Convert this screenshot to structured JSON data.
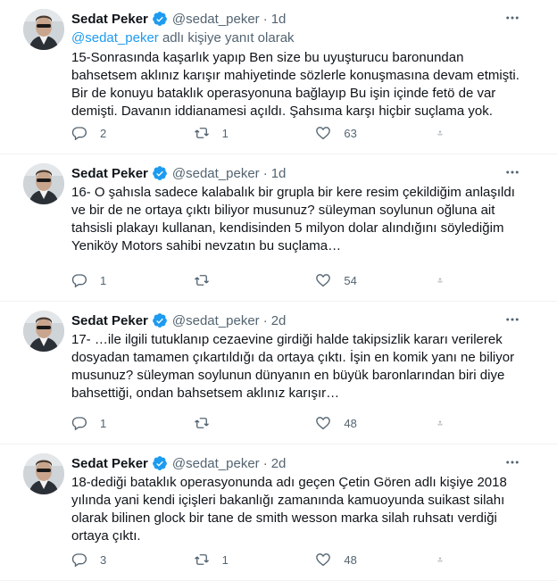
{
  "icons": {
    "reply": "reply-icon",
    "retweet": "retweet-icon",
    "like": "heart-icon",
    "share": "share-icon",
    "more": "more-icon",
    "verified": "verified-badge-icon"
  },
  "colors": {
    "verified": "#1d9bf0",
    "mention": "#1d9bf0",
    "secondary": "#536471"
  },
  "tweets": [
    {
      "name": "Sedat Peker",
      "handle": "@sedat_peker",
      "dot": "·",
      "time": "1d",
      "reply_to_prefix": "",
      "reply_to_mention": "@sedat_peker",
      "reply_to_suffix": " adlı kişiye yanıt olarak",
      "text": "15-Sonrasında kaşarlık yapıp Ben size bu uyuşturucu baronundan bahsetsem aklınız karışır mahiyetinde sözlerle konuşmasına devam etmişti. Bir de konuyu bataklık operasyonuna bağlayıp Bu işin içinde fetö de var demişti. Davanın iddianamesi açıldı.  Şahsıma karşı hiçbir suçlama yok.",
      "replies": "2",
      "retweets": "1",
      "likes": "63"
    },
    {
      "name": "Sedat Peker",
      "handle": "@sedat_peker",
      "dot": "·",
      "time": "1d",
      "text": "16- O şahısla sadece kalabalık bir grupla bir kere resim çekildiğim anlaşıldı ve bir de ne ortaya çıktı biliyor musunuz? süleyman soylunun oğluna ait tahsisli plakayı kullanan, kendisinden 5 milyon dolar alındığını söylediğim Yeniköy Motors sahibi nevzatın bu suçlama…",
      "replies": "1",
      "retweets": "",
      "likes": "54"
    },
    {
      "name": "Sedat Peker",
      "handle": "@sedat_peker",
      "dot": "·",
      "time": "2d",
      "text": "17- …ile ilgili tutuklanıp cezaevine girdiği halde takipsizlik kararı verilerek dosyadan tamamen çıkartıldığı da ortaya çıktı. İşin en komik yanı ne biliyor musunuz? süleyman soylunun dünyanın en büyük baronlarından biri diye bahsettiği, ondan bahsetsem aklınız karışır…",
      "replies": "1",
      "retweets": "",
      "likes": "48"
    },
    {
      "name": "Sedat Peker",
      "handle": "@sedat_peker",
      "dot": "·",
      "time": "2d",
      "text": "18-dediği bataklık operasyonunda adı geçen Çetin Gören adlı kişiye 2018 yılında yani kendi içişleri bakanlığı zamanında kamuoyunda suikast silahı olarak bilinen glock bir tane de smith wesson marka silah ruhsatı verdiği ortaya çıktı.",
      "replies": "3",
      "retweets": "1",
      "likes": "48"
    }
  ]
}
